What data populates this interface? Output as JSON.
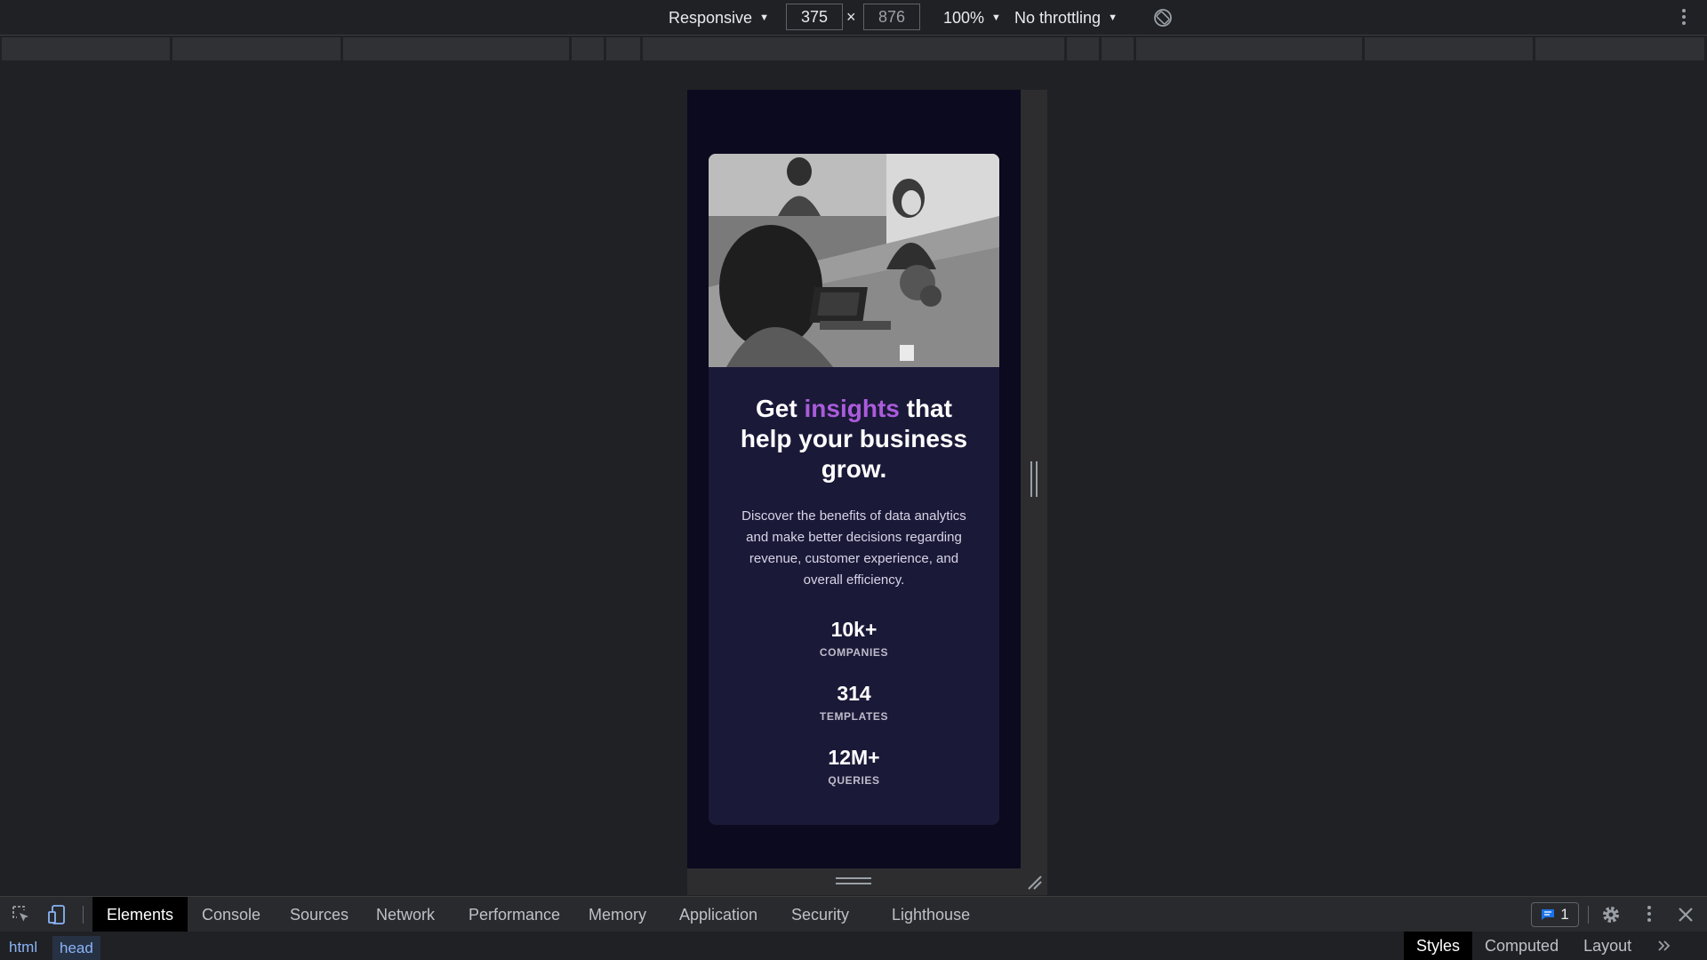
{
  "device_toolbar": {
    "device": "Responsive",
    "width": "375",
    "height": "876",
    "times": "×",
    "zoom": "100%",
    "throttling": "No throttling"
  },
  "page": {
    "headline_before": "Get ",
    "headline_accent": "insights",
    "headline_after": " that help your business grow.",
    "description": "Discover the benefits of data analytics and make better decisions regarding revenue, customer experience, and overall efficiency.",
    "stats": [
      {
        "value": "10k+",
        "label": "COMPANIES"
      },
      {
        "value": "314",
        "label": "TEMPLATES"
      },
      {
        "value": "12M+",
        "label": "QUERIES"
      }
    ],
    "colors": {
      "background": "#0c0a1e",
      "card": "#1b1938",
      "accent": "#aa5cdb"
    }
  },
  "devtools": {
    "tabs": [
      "Elements",
      "Console",
      "Sources",
      "Network",
      "Performance",
      "Memory",
      "Application",
      "Security",
      "Lighthouse"
    ],
    "active_tab": "Elements",
    "issues_count": "1",
    "breadcrumbs": [
      "html",
      "head"
    ],
    "side_tabs": [
      "Styles",
      "Computed",
      "Layout"
    ]
  },
  "icons": [
    "rotate-icon",
    "more-options-icon",
    "inspect-element-icon",
    "device-toolbar-icon",
    "issues-message-icon",
    "gear-icon",
    "close-icon",
    "chevron-double-right-icon"
  ]
}
